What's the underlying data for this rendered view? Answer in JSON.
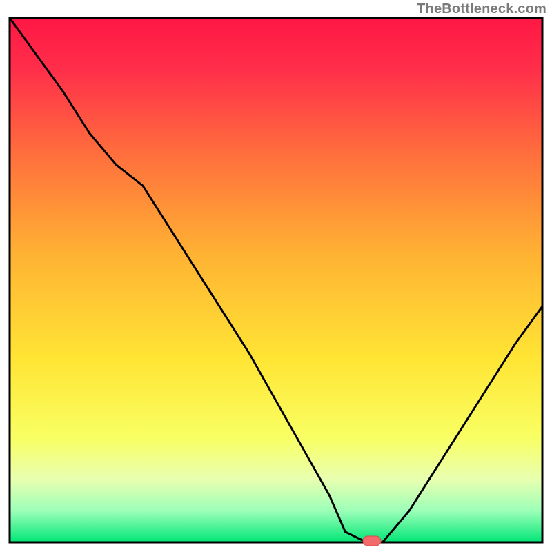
{
  "watermark": "TheBottleneck.com",
  "chart_data": {
    "type": "line",
    "title": "",
    "xlabel": "",
    "ylabel": "",
    "xlim": [
      0,
      100
    ],
    "ylim": [
      0,
      100
    ],
    "series": [
      {
        "name": "bottleneck-curve",
        "x": [
          0,
          5,
          10,
          15,
          20,
          25,
          30,
          35,
          40,
          45,
          50,
          55,
          60,
          63,
          67,
          70,
          75,
          80,
          85,
          90,
          95,
          100
        ],
        "values": [
          100,
          93,
          86,
          78,
          72,
          68,
          60,
          52,
          44,
          36,
          27,
          18,
          9,
          2,
          0,
          0,
          6,
          14,
          22,
          30,
          38,
          45
        ]
      }
    ],
    "marker": {
      "x": 68,
      "y": 0,
      "name": "optimal-point"
    },
    "background": {
      "gradient_stops": [
        {
          "pos": 0.0,
          "color": "#ff1744"
        },
        {
          "pos": 0.1,
          "color": "#ff2f4a"
        },
        {
          "pos": 0.25,
          "color": "#ff6b3d"
        },
        {
          "pos": 0.45,
          "color": "#ffb233"
        },
        {
          "pos": 0.65,
          "color": "#ffe534"
        },
        {
          "pos": 0.8,
          "color": "#f9ff63"
        },
        {
          "pos": 0.88,
          "color": "#e8ffb0"
        },
        {
          "pos": 0.94,
          "color": "#9cffb8"
        },
        {
          "pos": 1.0,
          "color": "#00e676"
        }
      ]
    },
    "colors": {
      "curve_stroke": "#000000",
      "frame_stroke": "#000000",
      "marker_fill": "#f46a6a",
      "marker_stroke": "#d94a4a"
    }
  }
}
